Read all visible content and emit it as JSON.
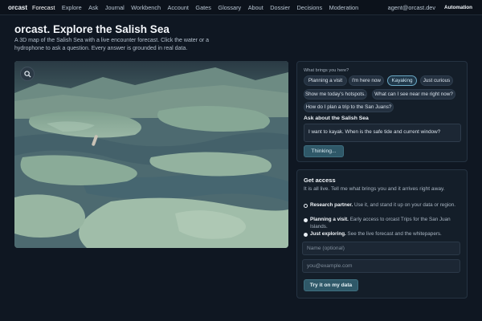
{
  "nav": {
    "brand": "orcast",
    "links": [
      "Forecast",
      "Explore",
      "Ask",
      "Journal",
      "Workbench",
      "Account",
      "Gates",
      "Glossary",
      "About",
      "Dossier",
      "Decisions",
      "Moderation"
    ],
    "active": "Forecast",
    "user_email": "agent@orcast.dev",
    "automation_label": "Automation"
  },
  "header": {
    "title": "orcast. Explore the Salish Sea",
    "subtitle": "A 3D map of the Salish Sea with a live encounter forecast. Click the water or a hydrophone to ask a question. Every answer is grounded in real data."
  },
  "map": {
    "search_icon": "search-icon"
  },
  "ask_panel": {
    "prompt_label": "What brings you here?",
    "chips": [
      "Planning a visit",
      "I'm here now",
      "Kayaking",
      "Just curious",
      "Show me today's hotspots.",
      "What can I see near me right now?",
      "How do I plan a trip to the San Juans?"
    ],
    "selected_chip": "Kayaking",
    "heading": "Ask about the Salish Sea",
    "input_value": "I want to kayak. When is the safe tide and current window?",
    "submit_label": "Thinking..."
  },
  "access_panel": {
    "title": "Get access",
    "description": "It is all live. Tell me what brings you and it arrives right away.",
    "options": [
      {
        "label": "Research partner.",
        "detail": "Use it, and stand it up on your data or region.",
        "checked": true
      },
      {
        "label": "Planning a visit.",
        "detail": "Early access to orcast Trips for the San Juan Islands.",
        "checked": false
      },
      {
        "label": "Just exploring.",
        "detail": "See the live forecast and the whitepapers.",
        "checked": false
      }
    ],
    "name_placeholder": "Name (optional)",
    "email_placeholder": "you@example.com",
    "submit_label": "Try it on my data"
  },
  "colors": {
    "accent": "#2f5868",
    "selected_chip_border": "#6aa8c4",
    "background": "#0f1722"
  }
}
